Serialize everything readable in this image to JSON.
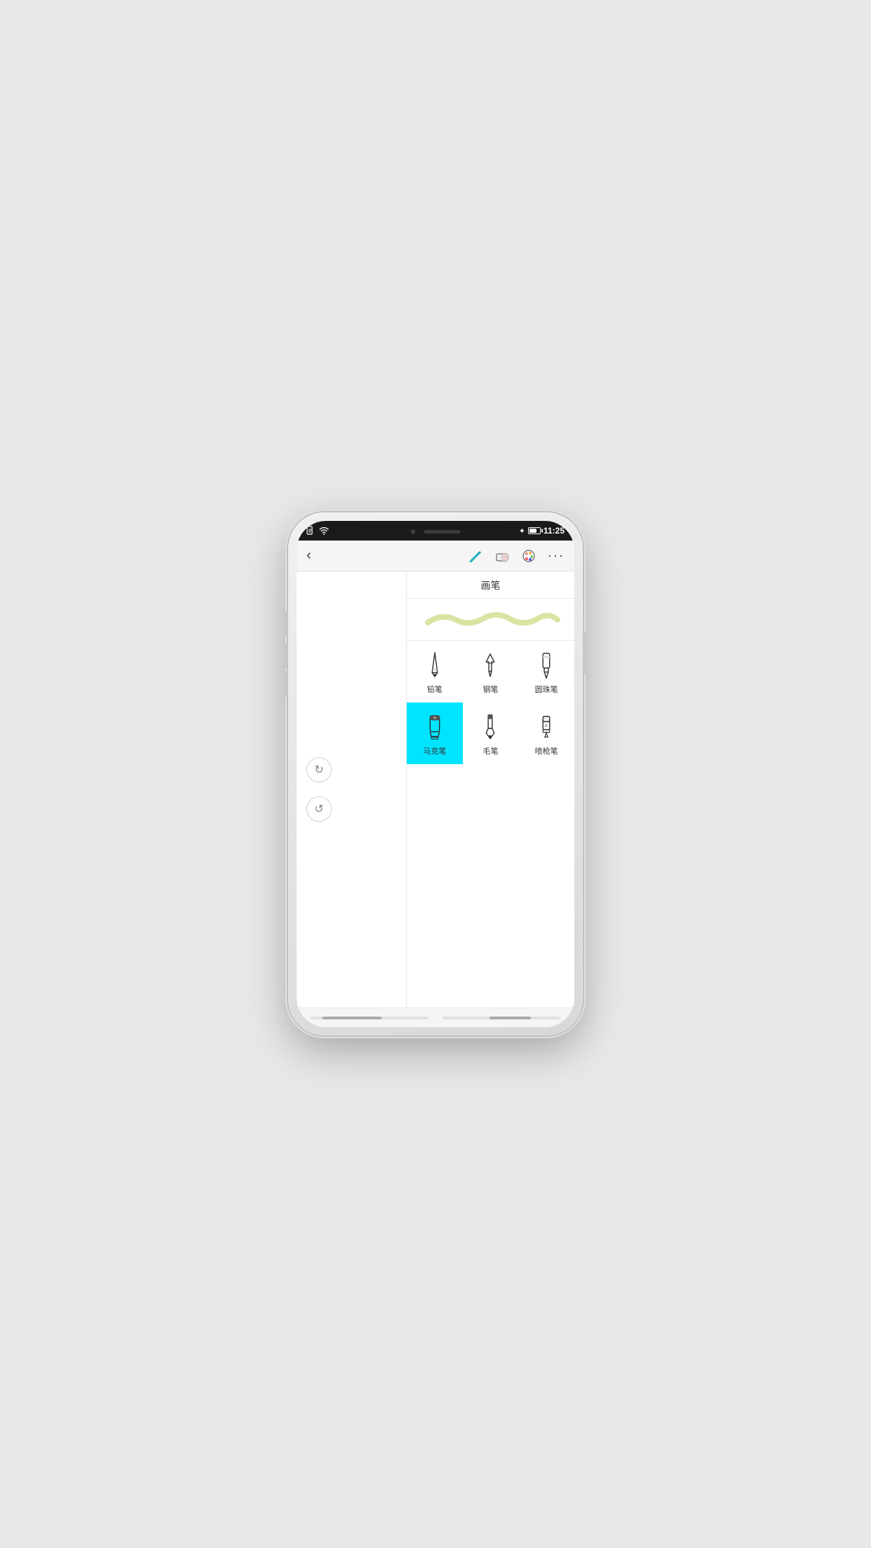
{
  "statusBar": {
    "time": "11:25",
    "bluetooth": "✦",
    "icons_left": [
      "doc",
      "wifi"
    ]
  },
  "toolbar": {
    "back_label": "‹",
    "brush_label": "画笔",
    "more_label": "···"
  },
  "panel": {
    "title": "画笔",
    "brushes": [
      {
        "id": "pencil",
        "label": "铅笔",
        "active": false
      },
      {
        "id": "pen",
        "label": "钢笔",
        "active": false
      },
      {
        "id": "ballpen",
        "label": "圆珠笔",
        "active": false
      },
      {
        "id": "marker",
        "label": "马克笔",
        "active": true
      },
      {
        "id": "brush",
        "label": "毛笔",
        "active": false
      },
      {
        "id": "spray",
        "label": "喷枪笔",
        "active": false
      }
    ]
  },
  "actions": {
    "redo_label": "↻",
    "undo_label": "↺"
  },
  "colors": {
    "accent": "#00e5ff",
    "stroke_preview": "#c8d8a0"
  }
}
